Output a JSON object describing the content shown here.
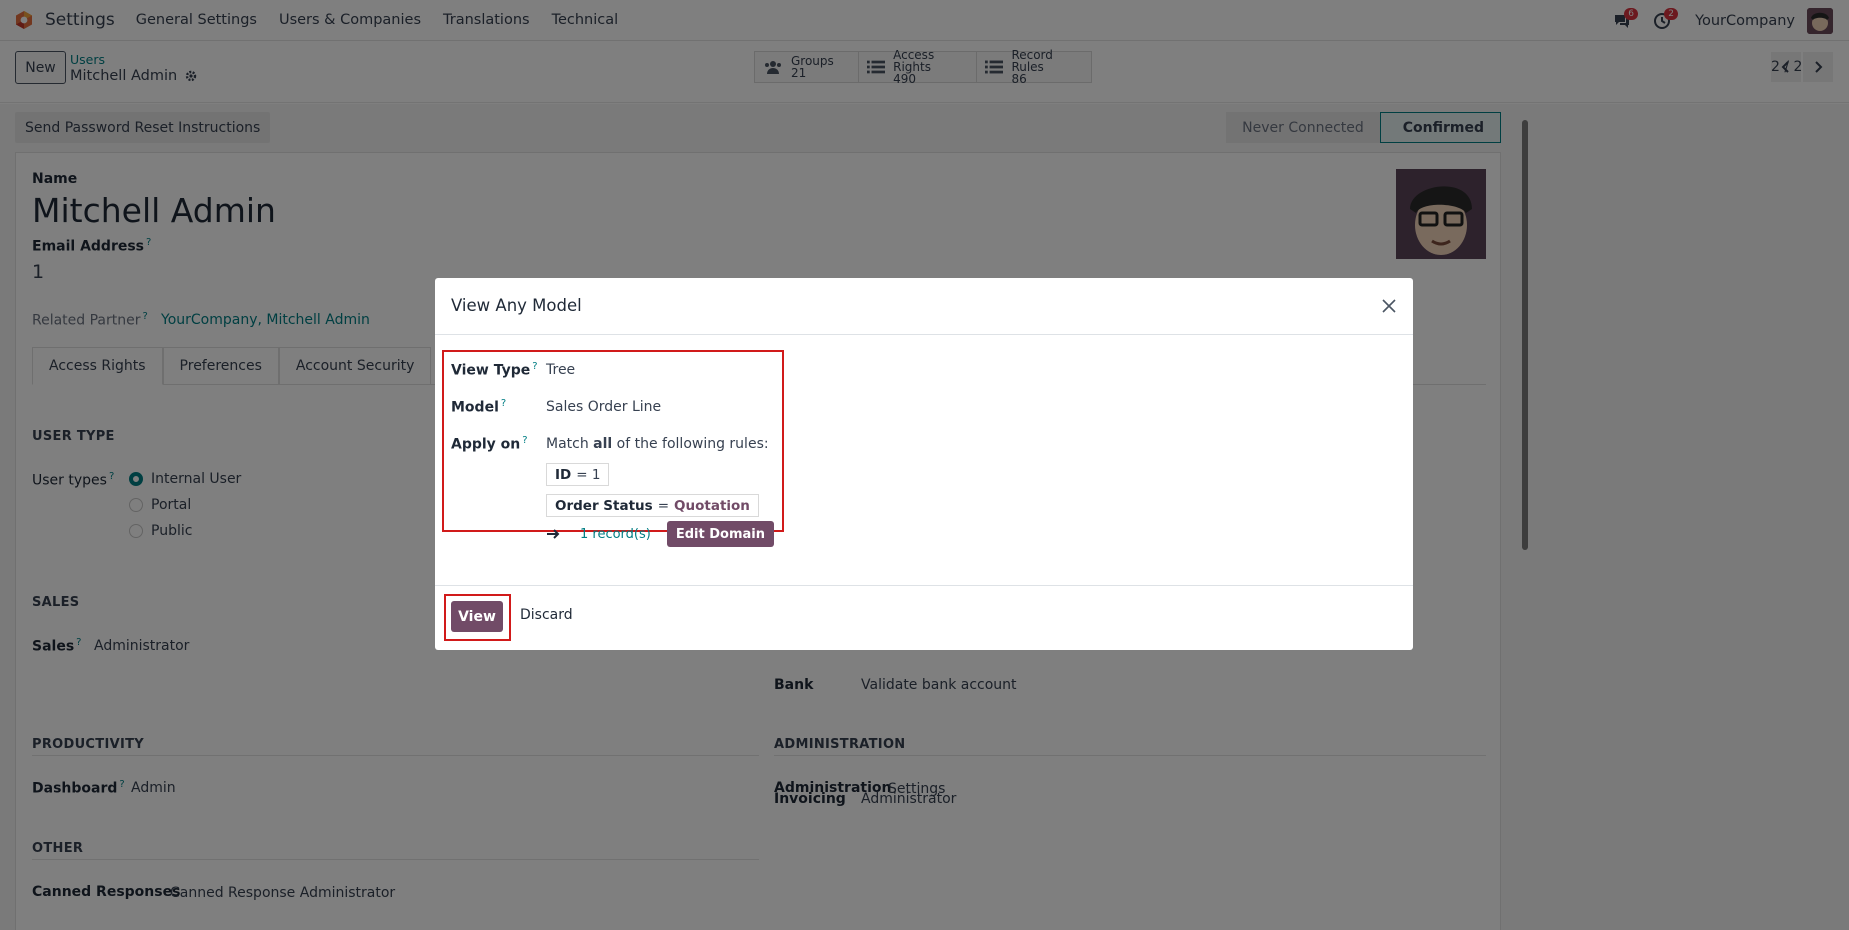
{
  "navbar": {
    "app_name": "Settings",
    "menu": [
      "General Settings",
      "Users & Companies",
      "Translations",
      "Technical"
    ],
    "messages_badge": "6",
    "activity_badge": "2",
    "company": "YourCompany"
  },
  "control": {
    "new_label": "New",
    "breadcrumb_parent": "Users",
    "breadcrumb_current": "Mitchell Admin",
    "smart_buttons": [
      {
        "label": "Groups",
        "count": "21",
        "icon": "users-icon"
      },
      {
        "label": "Access Rights",
        "count": "490",
        "icon": "list-icon"
      },
      {
        "label": "Record Rules",
        "count": "86",
        "icon": "list-icon"
      }
    ],
    "pager": "2 / 2"
  },
  "form": {
    "reset_button": "Send Password Reset Instructions",
    "status_stages": [
      "Never Connected",
      "Confirmed"
    ],
    "name_label": "Name",
    "name_value": "Mitchell Admin",
    "email_label": "Email Address",
    "email_value": "1",
    "related_partner_label": "Related Partner",
    "related_partner_value": "YourCompany, Mitchell Admin",
    "tabs": [
      "Access Rights",
      "Preferences",
      "Account Security"
    ],
    "user_type_section": "USER TYPE",
    "user_types_label": "User types",
    "user_types_options": [
      "Internal User",
      "Portal",
      "Public"
    ],
    "sales_section": "SALES",
    "sales_label": "Sales",
    "sales_value": "Administrator",
    "invoicing_label": "Invoicing",
    "invoicing_value": "Administrator",
    "bank_label": "Bank",
    "bank_value": "Validate bank account",
    "productivity_section": "PRODUCTIVITY",
    "dashboard_label": "Dashboard",
    "dashboard_value": "Admin",
    "administration_section": "ADMINISTRATION",
    "administration_label": "Administration",
    "administration_value": "Settings",
    "other_section": "OTHER",
    "canned_label": "Canned Responses",
    "canned_value": "Canned Response Administrator"
  },
  "modal": {
    "title": "View Any Model",
    "view_type_label": "View Type",
    "view_type_value": "Tree",
    "model_label": "Model",
    "model_value": "Sales Order Line",
    "apply_on_label": "Apply on",
    "match_prefix": "Match",
    "match_word": "all",
    "match_suffix": "of the following rules:",
    "rule1_field": "ID",
    "rule1_op": "= 1",
    "rule2_field": "Order Status",
    "rule2_op": "=",
    "rule2_value": "Quotation",
    "records_link": "1 record(s)",
    "edit_domain": "Edit Domain",
    "view_button": "View",
    "discard_button": "Discard"
  },
  "colors": {
    "brand": "#714b67",
    "link": "#017e84",
    "highlight_box": "#d11a1a",
    "badge": "#d9333f"
  }
}
